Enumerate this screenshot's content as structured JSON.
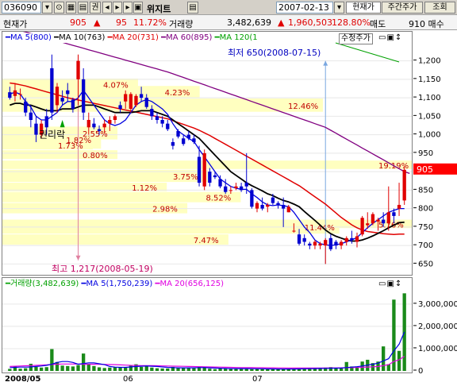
{
  "toolbar": {
    "code": "036090",
    "name": "위지트",
    "date": "2007-02-13",
    "price_btn": "현재가",
    "weekly_btn": "주간주가",
    "query_btn": "조회",
    "menu_label": "권"
  },
  "quote": {
    "price_label": "현재가",
    "price": "905",
    "change": "95",
    "change_pct": "11.72%",
    "volume_label": "거래량",
    "volume": "3,482,639",
    "prev_volume": "1,960,503",
    "volume_ratio": "128.80%",
    "ask_label": "매도",
    "ask": "910 매수"
  },
  "colors": {
    "up": "#e00000",
    "down": "#0000d0",
    "ma5": "#0000e0",
    "ma10": "#000000",
    "ma20": "#e00000",
    "ma60": "#800080",
    "ma120": "#00a000",
    "band": "#ffffc0",
    "current": "#ff0000"
  },
  "price_legend": {
    "ma5": "MA 5(800)",
    "ma10": "MA 10(763)",
    "ma20": "MA 20(731)",
    "ma60": "MA 60(895)",
    "ma120": "MA 120(1",
    "adjusted": "수정주가"
  },
  "volume_legend": {
    "vol": "거래량(3,482,639)",
    "ma5": "MA 5(1,750,239)",
    "ma20": "MA 20(656,125)"
  },
  "annotations": {
    "low": "최저 650(2008-07-15)",
    "high": "최고 1,217(2008-05-19)",
    "rights": "권리락",
    "current_price": "905"
  },
  "chart_data": {
    "type": "candlestick",
    "price_axis": {
      "min": 625,
      "max": 1240,
      "ticks": [
        650,
        700,
        750,
        800,
        850,
        900,
        950,
        1000,
        1050,
        1100,
        1150,
        1200
      ]
    },
    "volume_axis": {
      "min": 0,
      "max": 3600000,
      "ticks": [
        "0",
        "1,000,000",
        "2,000,000",
        "3,000,000"
      ]
    },
    "x_labels": [
      "2008/05",
      "06",
      "07"
    ],
    "candles": [
      [
        1115,
        1130,
        1095,
        1100
      ],
      [
        1105,
        1140,
        1090,
        1120
      ],
      [
        1110,
        1125,
        1095,
        1110
      ],
      [
        1090,
        1100,
        1050,
        1060
      ],
      [
        1060,
        1080,
        1020,
        1040
      ],
      [
        1030,
        1050,
        980,
        1000
      ],
      [
        1000,
        1040,
        990,
        1030
      ],
      [
        1050,
        1070,
        1000,
        1020
      ],
      [
        1180,
        1217,
        1040,
        1060
      ],
      [
        1080,
        1140,
        1060,
        1130
      ],
      [
        1100,
        1120,
        1080,
        1090
      ],
      [
        1120,
        1140,
        1090,
        1110
      ],
      [
        1095,
        1100,
        1060,
        1070
      ],
      [
        1150,
        1217,
        1080,
        1200
      ],
      [
        1150,
        1180,
        1040,
        1060
      ],
      [
        1020,
        1060,
        1000,
        1040
      ],
      [
        1030,
        1045,
        1015,
        1020
      ],
      [
        1015,
        1025,
        1000,
        1010
      ],
      [
        1020,
        1040,
        1005,
        1030
      ],
      [
        1030,
        1050,
        1010,
        1040
      ],
      [
        1040,
        1055,
        1030,
        1050
      ],
      [
        1080,
        1090,
        1060,
        1070
      ],
      [
        1090,
        1120,
        1070,
        1110
      ],
      [
        1070,
        1115,
        1060,
        1110
      ],
      [
        1080,
        1110,
        1075,
        1105
      ],
      [
        1110,
        1130,
        1090,
        1100
      ],
      [
        1100,
        1110,
        1070,
        1075
      ],
      [
        1070,
        1080,
        1040,
        1050
      ],
      [
        1050,
        1060,
        1030,
        1040
      ],
      [
        1040,
        1050,
        1020,
        1030
      ],
      [
        1030,
        1040,
        1010,
        1015
      ],
      [
        980,
        990,
        960,
        970
      ],
      [
        1010,
        1015,
        990,
        995
      ],
      [
        990,
        1000,
        970,
        975
      ],
      [
        1000,
        1010,
        985,
        990
      ],
      [
        990,
        1000,
        975,
        980
      ],
      [
        940,
        970,
        860,
        870
      ],
      [
        860,
        960,
        850,
        950
      ],
      [
        900,
        910,
        860,
        870
      ],
      [
        890,
        900,
        880,
        885
      ],
      [
        880,
        890,
        855,
        860
      ],
      [
        860,
        880,
        840,
        845
      ],
      [
        850,
        860,
        840,
        850
      ],
      [
        855,
        870,
        850,
        860
      ],
      [
        860,
        870,
        845,
        850
      ],
      [
        870,
        950,
        840,
        860
      ],
      [
        850,
        855,
        800,
        805
      ],
      [
        800,
        820,
        790,
        815
      ],
      [
        810,
        830,
        795,
        800
      ],
      [
        805,
        815,
        790,
        810
      ],
      [
        830,
        840,
        810,
        815
      ],
      [
        815,
        820,
        800,
        810
      ],
      [
        810,
        830,
        750,
        800
      ],
      [
        790,
        810,
        790,
        805
      ],
      [
        740,
        760,
        735,
        740
      ],
      [
        730,
        745,
        700,
        705
      ],
      [
        720,
        730,
        700,
        710
      ],
      [
        705,
        710,
        690,
        700
      ],
      [
        700,
        715,
        690,
        710
      ],
      [
        700,
        710,
        690,
        705
      ],
      [
        700,
        720,
        650,
        715
      ],
      [
        720,
        730,
        685,
        690
      ],
      [
        710,
        715,
        690,
        700
      ],
      [
        700,
        715,
        690,
        710
      ],
      [
        710,
        725,
        700,
        720
      ],
      [
        720,
        740,
        705,
        715
      ],
      [
        710,
        735,
        695,
        725
      ],
      [
        730,
        780,
        725,
        775
      ],
      [
        755,
        790,
        745,
        760
      ],
      [
        760,
        790,
        755,
        785
      ],
      [
        765,
        775,
        740,
        770
      ],
      [
        770,
        790,
        750,
        760
      ],
      [
        760,
        860,
        740,
        790
      ],
      [
        790,
        800,
        760,
        780
      ],
      [
        800,
        870,
        780,
        810
      ],
      [
        822,
        915,
        810,
        905
      ]
    ],
    "ma5": [
      1110,
      1115,
      1110,
      1090,
      1075,
      1050,
      1040,
      1040,
      1050,
      1060,
      1080,
      1090,
      1090,
      1100,
      1120,
      1100,
      1080,
      1060,
      1040,
      1030,
      1025,
      1030,
      1040,
      1060,
      1080,
      1090,
      1095,
      1090,
      1080,
      1070,
      1055,
      1030,
      1010,
      1000,
      990,
      982,
      960,
      940,
      920,
      900,
      880,
      870,
      860,
      855,
      852,
      852,
      840,
      830,
      818,
      810,
      808,
      810,
      808,
      805,
      790,
      770,
      750,
      735,
      715,
      705,
      702,
      700,
      702,
      705,
      710,
      715,
      722,
      735,
      748,
      760,
      770,
      780,
      790,
      795,
      800,
      800
    ],
    "ma10": [
      1080,
      1085,
      1085,
      1080,
      1080,
      1075,
      1070,
      1065,
      1065,
      1065,
      1070,
      1070,
      1070,
      1075,
      1080,
      1080,
      1080,
      1075,
      1070,
      1065,
      1060,
      1060,
      1060,
      1060,
      1062,
      1065,
      1065,
      1065,
      1060,
      1055,
      1050,
      1040,
      1030,
      1020,
      1010,
      1000,
      990,
      975,
      960,
      945,
      930,
      915,
      900,
      890,
      880,
      870,
      862,
      855,
      848,
      840,
      835,
      828,
      822,
      818,
      812,
      805,
      792,
      780,
      768,
      755,
      742,
      732,
      725,
      720,
      715,
      712,
      712,
      715,
      720,
      726,
      733,
      740,
      748,
      755,
      762,
      763
    ],
    "ma20": [
      1140,
      1138,
      1135,
      1132,
      1128,
      1124,
      1120,
      1116,
      1112,
      1108,
      1104,
      1100,
      1097,
      1094,
      1091,
      1088,
      1085,
      1082,
      1079,
      1076,
      1073,
      1070,
      1067,
      1064,
      1061,
      1058,
      1055,
      1052,
      1049,
      1046,
      1043,
      1038,
      1033,
      1028,
      1023,
      1018,
      1012,
      1005,
      998,
      990,
      982,
      974,
      966,
      958,
      950,
      942,
      934,
      926,
      918,
      910,
      902,
      894,
      886,
      878,
      870,
      862,
      852,
      842,
      832,
      822,
      812,
      800,
      788,
      776,
      766,
      756,
      748,
      742,
      738,
      736,
      734,
      732,
      731,
      730,
      731,
      731
    ],
    "ma60": [
      1290,
      1286,
      1282,
      1278,
      1274,
      1270,
      1266,
      1262,
      1258,
      1254,
      1250,
      1246,
      1242,
      1238,
      1234,
      1230,
      1226,
      1222,
      1218,
      1214,
      1210,
      1206,
      1202,
      1198,
      1194,
      1190,
      1186,
      1182,
      1178,
      1174,
      1170,
      1165,
      1160,
      1155,
      1150,
      1145,
      1140,
      1135,
      1130,
      1125,
      1120,
      1115,
      1110,
      1105,
      1100,
      1095,
      1090,
      1085,
      1080,
      1075,
      1070,
      1065,
      1060,
      1055,
      1050,
      1045,
      1040,
      1035,
      1030,
      1025,
      1020,
      1012,
      1004,
      996,
      988,
      980,
      972,
      964,
      956,
      948,
      940,
      932,
      924,
      916,
      908,
      900,
      895
    ],
    "volume": [
      90,
      200,
      100,
      120,
      320,
      180,
      150,
      170,
      980,
      400,
      240,
      220,
      200,
      260,
      780,
      300,
      220,
      160,
      130,
      150,
      160,
      170,
      160,
      240,
      300,
      180,
      200,
      150,
      120,
      110,
      110,
      180,
      160,
      130,
      150,
      120,
      200,
      180,
      100,
      80,
      120,
      110,
      100,
      100,
      120,
      110,
      80,
      90,
      100,
      80,
      90,
      80,
      100,
      90,
      70,
      120,
      110,
      100,
      100,
      120,
      150,
      170,
      120,
      110,
      400,
      200,
      200,
      420,
      500,
      350,
      420,
      1100,
      300,
      3200,
      900,
      3482
    ],
    "volume_ma5": [
      150,
      160,
      170,
      170,
      180,
      200,
      220,
      250,
      300,
      380,
      420,
      420,
      380,
      300,
      330,
      360,
      360,
      320,
      280,
      200,
      170,
      160,
      160,
      180,
      200,
      210,
      220,
      210,
      200,
      180,
      160,
      150,
      140,
      140,
      140,
      140,
      150,
      150,
      140,
      130,
      120,
      110,
      105,
      105,
      105,
      105,
      100,
      95,
      95,
      90,
      90,
      85,
      85,
      85,
      85,
      90,
      95,
      100,
      105,
      110,
      115,
      120,
      125,
      130,
      150,
      170,
      190,
      220,
      260,
      300,
      350,
      450,
      550,
      900,
      1200,
      1750
    ],
    "volume_ma20": [
      200,
      210,
      220,
      230,
      240,
      250,
      260,
      270,
      290,
      300,
      310,
      310,
      310,
      305,
      300,
      300,
      300,
      295,
      290,
      285,
      280,
      270,
      260,
      250,
      245,
      240,
      240,
      235,
      230,
      225,
      220,
      215,
      210,
      205,
      200,
      195,
      190,
      185,
      180,
      175,
      170,
      165,
      160,
      155,
      150,
      148,
      146,
      144,
      142,
      140,
      138,
      136,
      134,
      132,
      130,
      130,
      130,
      130,
      130,
      130,
      132,
      134,
      136,
      138,
      145,
      150,
      155,
      165,
      175,
      185,
      195,
      240,
      280,
      420,
      500,
      656
    ],
    "bands": [
      {
        "price_top": 1152,
        "price_bottom": 1120,
        "x_end": 0.33,
        "label": "4.07%"
      },
      {
        "price_top": 1132,
        "price_bottom": 1098,
        "x_end": 0.48,
        "label": "4.23%"
      },
      {
        "price_top": 1098,
        "price_bottom": 1060,
        "x_end": 0.78,
        "label": "12.46%"
      },
      {
        "price_top": 1022,
        "price_bottom": 985,
        "x_end": 0.28,
        "label": "2.55%"
      },
      {
        "price_top": 1012,
        "price_bottom": 960,
        "x_end": 0.24,
        "label": "1.82%"
      },
      {
        "price_top": 985,
        "price_bottom": 958,
        "x_end": 0.22,
        "label": "1.73%"
      },
      {
        "price_top": 958,
        "price_bottom": 932,
        "x_end": 0.28,
        "label": "0.80%"
      },
      {
        "price_top": 930,
        "price_bottom": 905,
        "x_end": 1.0,
        "label": "19.19%"
      },
      {
        "price_top": 905,
        "price_bottom": 870,
        "x_end": 0.5,
        "label": "3.75%"
      },
      {
        "price_top": 870,
        "price_bottom": 845,
        "x_end": 0.4,
        "label": "1.12%"
      },
      {
        "price_top": 845,
        "price_bottom": 815,
        "x_end": 0.58,
        "label": "8.52%"
      },
      {
        "price_top": 815,
        "price_bottom": 785,
        "x_end": 0.45,
        "label": "2.98%"
      },
      {
        "price_top": 770,
        "price_bottom": 730,
        "x_end": 0.82,
        "label": "11.44%"
      },
      {
        "price_top": 730,
        "price_bottom": 700,
        "x_end": 0.55,
        "label": "7.47%"
      },
      {
        "price_top": 770,
        "price_bottom": 745,
        "x_end": 1.0,
        "label": "5.76%"
      }
    ]
  }
}
